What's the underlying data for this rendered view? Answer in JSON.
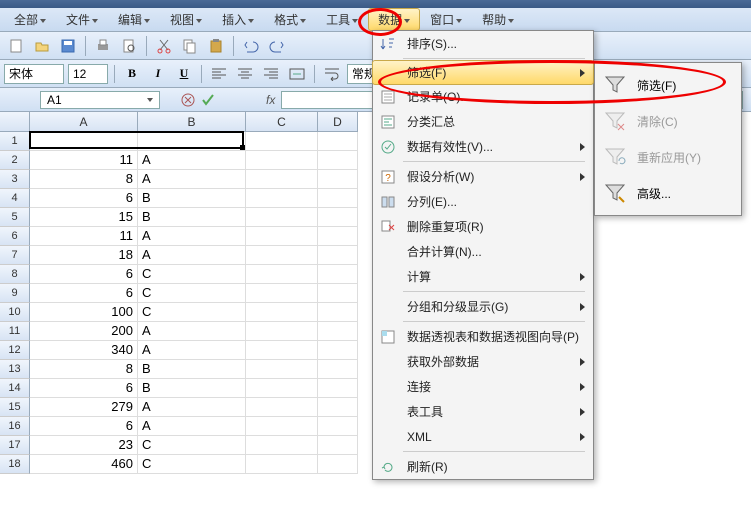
{
  "menubar": {
    "items": [
      "全部",
      "文件",
      "编辑",
      "视图",
      "插入",
      "格式",
      "工具",
      "数据",
      "窗口",
      "帮助"
    ],
    "active_index": 7
  },
  "formatbar": {
    "font_name": "宋体",
    "font_size": "12",
    "style_name": "常规"
  },
  "namebox": {
    "value": "A1"
  },
  "columns": [
    "A",
    "B",
    "C",
    "D"
  ],
  "rows": [
    {
      "n": 1,
      "a": "",
      "b": ""
    },
    {
      "n": 2,
      "a": "11",
      "b": "A"
    },
    {
      "n": 3,
      "a": "8",
      "b": "A"
    },
    {
      "n": 4,
      "a": "6",
      "b": "B"
    },
    {
      "n": 5,
      "a": "15",
      "b": "B"
    },
    {
      "n": 6,
      "a": "11",
      "b": "A"
    },
    {
      "n": 7,
      "a": "18",
      "b": "A"
    },
    {
      "n": 8,
      "a": "6",
      "b": "C"
    },
    {
      "n": 9,
      "a": "6",
      "b": "C"
    },
    {
      "n": 10,
      "a": "100",
      "b": "C"
    },
    {
      "n": 11,
      "a": "200",
      "b": "A"
    },
    {
      "n": 12,
      "a": "340",
      "b": "A"
    },
    {
      "n": 13,
      "a": "8",
      "b": "B"
    },
    {
      "n": 14,
      "a": "6",
      "b": "B"
    },
    {
      "n": 15,
      "a": "279",
      "b": "A"
    },
    {
      "n": 16,
      "a": "6",
      "b": "A"
    },
    {
      "n": 17,
      "a": "23",
      "b": "C"
    },
    {
      "n": 18,
      "a": "460",
      "b": "C"
    }
  ],
  "dropdown": {
    "items": [
      {
        "label": "排序(S)...",
        "icon": "sort"
      },
      {
        "label": "筛选(F)",
        "icon": "",
        "submenu": true,
        "highlight": true
      },
      {
        "label": "记录单(O)...",
        "icon": "form"
      },
      {
        "label": "分类汇总",
        "icon": "subtotal"
      },
      {
        "label": "数据有效性(V)...",
        "icon": "validation",
        "submenu": true
      },
      {
        "label": "假设分析(W)",
        "icon": "whatif",
        "submenu": true
      },
      {
        "label": "分列(E)...",
        "icon": "textcol"
      },
      {
        "label": "删除重复项(R)",
        "icon": "dedup"
      },
      {
        "label": "合并计算(N)...",
        "icon": ""
      },
      {
        "label": "计算",
        "icon": "",
        "submenu": true
      },
      {
        "label": "分组和分级显示(G)",
        "icon": "",
        "submenu": true
      },
      {
        "label": "数据透视表和数据透视图向导(P)",
        "icon": "pivot"
      },
      {
        "label": "获取外部数据",
        "icon": "",
        "submenu": true
      },
      {
        "label": "连接",
        "icon": "",
        "submenu": true
      },
      {
        "label": "表工具",
        "icon": "",
        "submenu": true
      },
      {
        "label": "XML",
        "icon": "",
        "submenu": true
      },
      {
        "label": "刷新(R)",
        "icon": "refresh"
      }
    ]
  },
  "submenu": {
    "items": [
      {
        "label": "筛选(F)",
        "icon": "funnel",
        "enabled": true
      },
      {
        "label": "清除(C)",
        "icon": "funnel-clear",
        "enabled": false
      },
      {
        "label": "重新应用(Y)",
        "icon": "funnel-reapply",
        "enabled": false
      },
      {
        "label": "高级...",
        "icon": "funnel-adv",
        "enabled": true
      }
    ]
  }
}
